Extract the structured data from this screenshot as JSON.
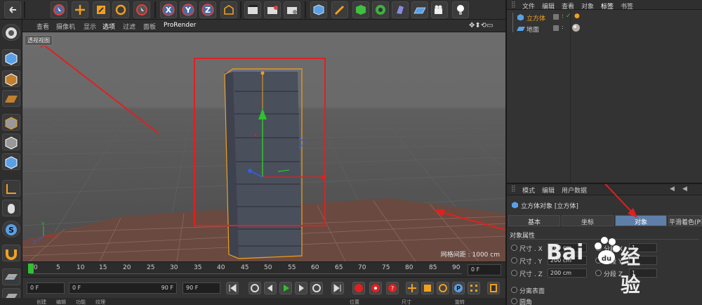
{
  "toolbar": {
    "icons": [
      "undo-icon",
      "live-selection-icon",
      "move-icon",
      "scale-icon",
      "rotate-icon",
      "last-tool-icon",
      "x-axis-icon",
      "y-axis-icon",
      "z-axis-icon",
      "coordinate-system-icon",
      "render-view-icon",
      "render-picture-viewer-icon",
      "edit-render-settings-icon",
      "cube-icon",
      "pen-icon",
      "subdivision-icon",
      "array-icon",
      "deformer-icon",
      "floor-icon",
      "camera-icon",
      "light-icon"
    ],
    "axis_labels": {
      "x": "X",
      "y": "Y",
      "z": "Z"
    }
  },
  "viewport_menu": {
    "items": [
      "查看",
      "摄像机",
      "显示",
      "选项",
      "过滤",
      "面板",
      "ProRender"
    ]
  },
  "viewport": {
    "label": "透视视图",
    "grid_spacing": "网格间距 : 1000 cm",
    "axis_x": "X",
    "axis_y": "Y",
    "axis_z": "Z"
  },
  "timeline": {
    "ticks": [
      "0",
      "5",
      "10",
      "15",
      "20",
      "25",
      "30",
      "35",
      "40",
      "45",
      "50",
      "55",
      "60",
      "65",
      "70",
      "75",
      "80",
      "85",
      "90"
    ],
    "current_frame": "0 F"
  },
  "playback": {
    "start_frame": "0 F",
    "range_start": "0 F",
    "range_end": "90 F",
    "end_frame": "90 F"
  },
  "bottom_menu": [
    "创建",
    "编辑",
    "功能",
    "纹理",
    "位置",
    "尺寸",
    "旋转"
  ],
  "object_manager": {
    "menu": [
      "文件",
      "编辑",
      "查看",
      "对象",
      "标签",
      "书签"
    ],
    "objects": [
      {
        "name": "立方体"
      },
      {
        "name": "地面"
      }
    ]
  },
  "attribute_manager": {
    "menu": [
      "模式",
      "编辑",
      "用户数据"
    ],
    "title": "立方体对象 [立方体]",
    "tabs": [
      "基本",
      "坐标",
      "对象",
      "平滑着色(Ph"
    ],
    "active_tab": "对象",
    "section": "对象属性",
    "props": [
      {
        "label": "尺寸 . X",
        "value": "200 cm",
        "seg_label": "分段 X",
        "seg_value": "1"
      },
      {
        "label": "尺寸 . Y",
        "value": "200 cm",
        "seg_label": "分段 Y",
        "seg_value": "1"
      },
      {
        "label": "尺寸 . Z",
        "value": "200 cm",
        "seg_label": "分段 Z",
        "seg_value": "1"
      }
    ],
    "separate_surfaces": "分离表面",
    "fillet": "圆角"
  },
  "watermark": {
    "text": "Bai",
    "suffix": "经验"
  },
  "colors": {
    "accent_blue": "#5aa0e6",
    "selection_orange": "#f0a020",
    "annotation_red": "#e02020",
    "active_tab": "#5e7fa8"
  }
}
